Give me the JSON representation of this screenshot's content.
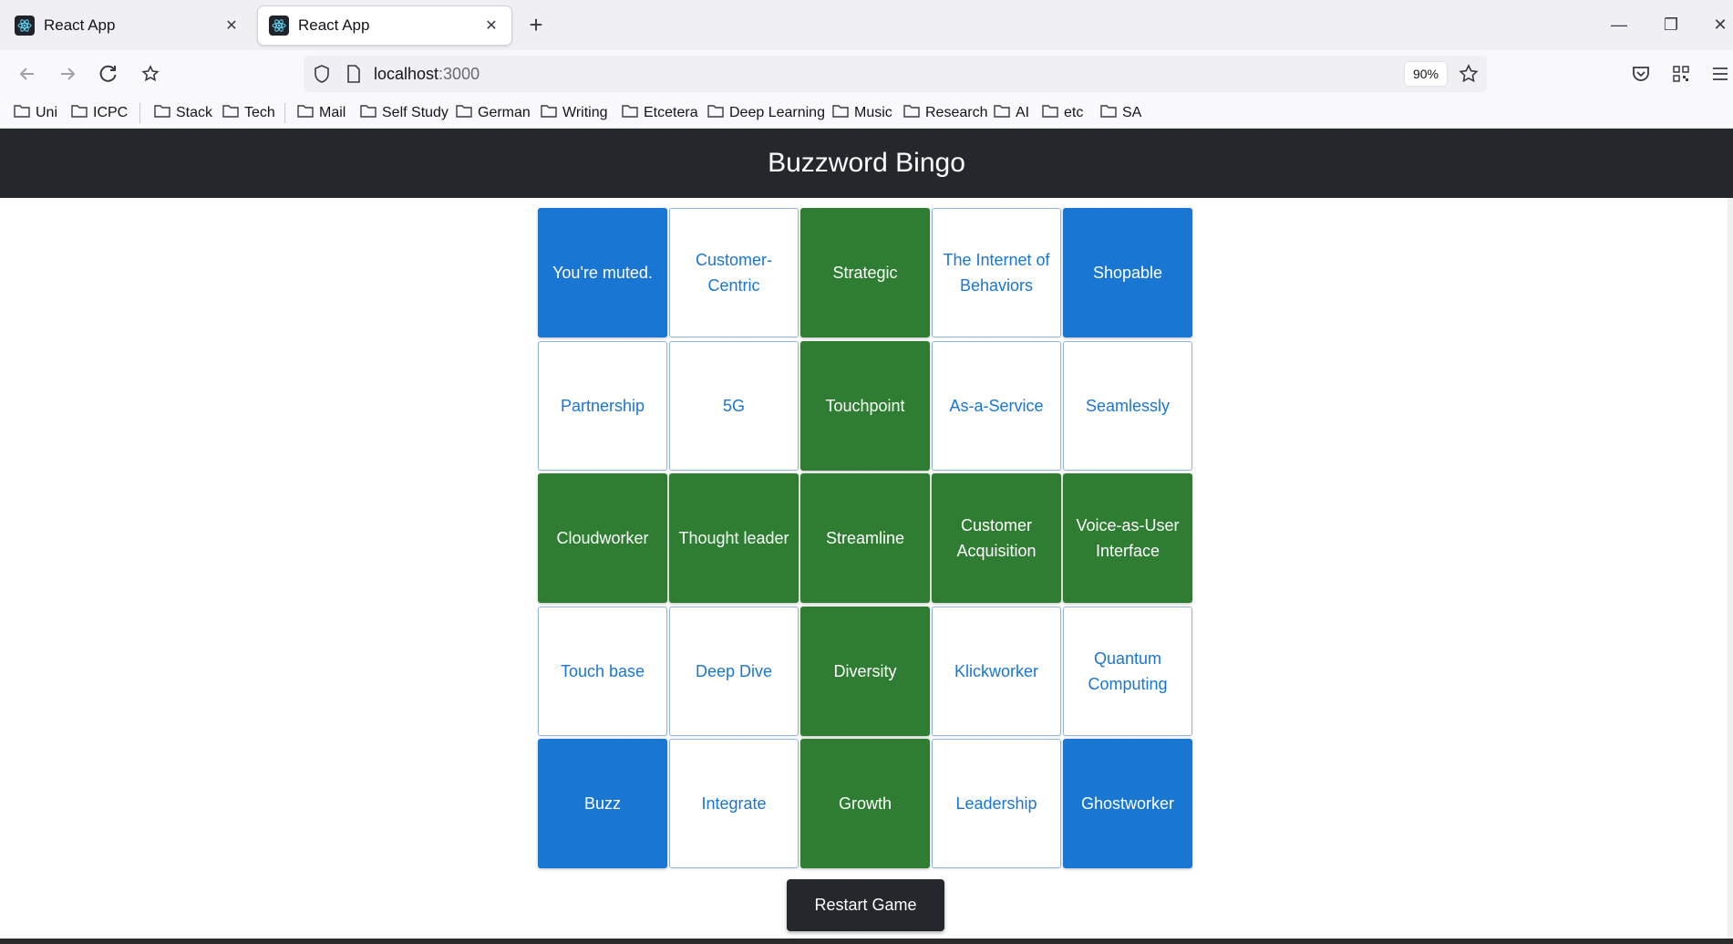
{
  "browser": {
    "tabs": [
      {
        "label": "React App",
        "active": false
      },
      {
        "label": "React App",
        "active": true
      }
    ],
    "url_host": "localhost",
    "url_port": ":3000",
    "zoom": "90%",
    "bookmarks": [
      "Uni",
      "ICPC",
      "Stack",
      "Tech",
      "Mail",
      "Self Study",
      "German",
      "Writing",
      "Etcetera",
      "Deep Learning",
      "Music",
      "Research",
      "AI",
      "etc",
      "SA"
    ]
  },
  "app": {
    "title": "Buzzword Bingo",
    "restart_label": "Restart Game"
  },
  "board": [
    [
      {
        "text": "You're muted.",
        "state": "free"
      },
      {
        "text": "Customer-Centric",
        "state": "unmarked"
      },
      {
        "text": "Strategic",
        "state": "marked"
      },
      {
        "text": "The Internet of Behaviors",
        "state": "unmarked"
      },
      {
        "text": "Shopable",
        "state": "free"
      }
    ],
    [
      {
        "text": "Partnership",
        "state": "unmarked"
      },
      {
        "text": "5G",
        "state": "unmarked"
      },
      {
        "text": "Touchpoint",
        "state": "marked"
      },
      {
        "text": "As-a-Service",
        "state": "unmarked"
      },
      {
        "text": "Seamlessly",
        "state": "unmarked"
      }
    ],
    [
      {
        "text": "Cloudworker",
        "state": "marked"
      },
      {
        "text": "Thought leader",
        "state": "marked"
      },
      {
        "text": "Streamline",
        "state": "marked"
      },
      {
        "text": "Customer Acquisition",
        "state": "marked"
      },
      {
        "text": "Voice-as-User Interface",
        "state": "marked"
      }
    ],
    [
      {
        "text": "Touch base",
        "state": "unmarked"
      },
      {
        "text": "Deep Dive",
        "state": "unmarked"
      },
      {
        "text": "Diversity",
        "state": "marked"
      },
      {
        "text": "Klickworker",
        "state": "unmarked"
      },
      {
        "text": "Quantum Computing",
        "state": "unmarked"
      }
    ],
    [
      {
        "text": "Buzz",
        "state": "free"
      },
      {
        "text": "Integrate",
        "state": "unmarked"
      },
      {
        "text": "Growth",
        "state": "marked"
      },
      {
        "text": "Leadership",
        "state": "unmarked"
      },
      {
        "text": "Ghostworker",
        "state": "free"
      }
    ]
  ],
  "colors": {
    "header_bg": "#24272b",
    "free_cell": "#1976d2",
    "marked_cell": "#2e7d32",
    "unmarked_text": "#1976d2"
  }
}
